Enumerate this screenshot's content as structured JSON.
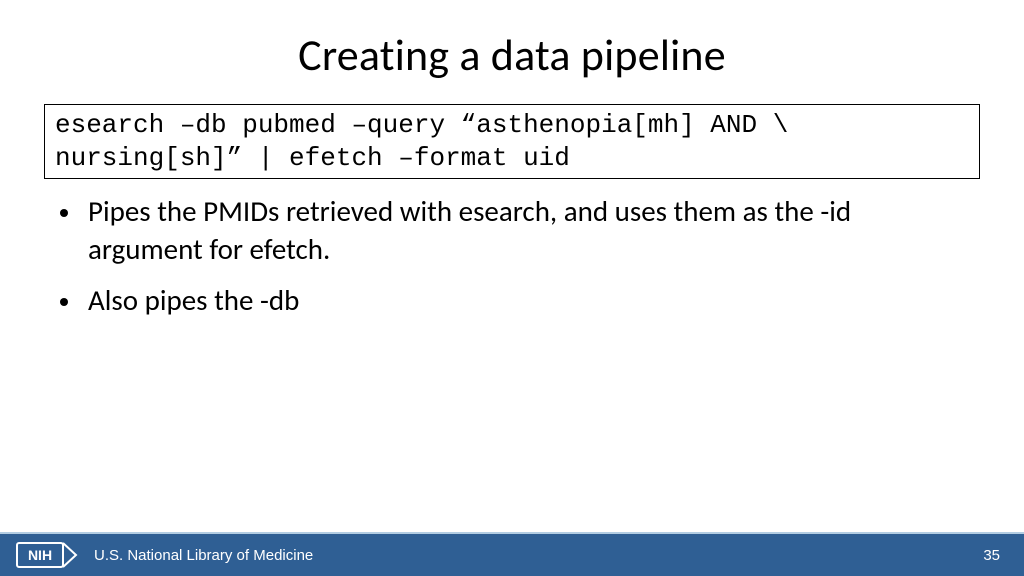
{
  "title": "Creating a data pipeline",
  "code_line1": "esearch –db pubmed –query “asthenopia[mh] AND \\",
  "code_line2": "nursing[sh]” | efetch –format uid",
  "bullets": [
    "Pipes the PMIDs retrieved with esearch, and uses them as the -id argument for efetch.",
    "Also pipes the -db"
  ],
  "footer": {
    "nih_label": "NIH",
    "org": "U.S. National Library of Medicine",
    "page": "35"
  }
}
